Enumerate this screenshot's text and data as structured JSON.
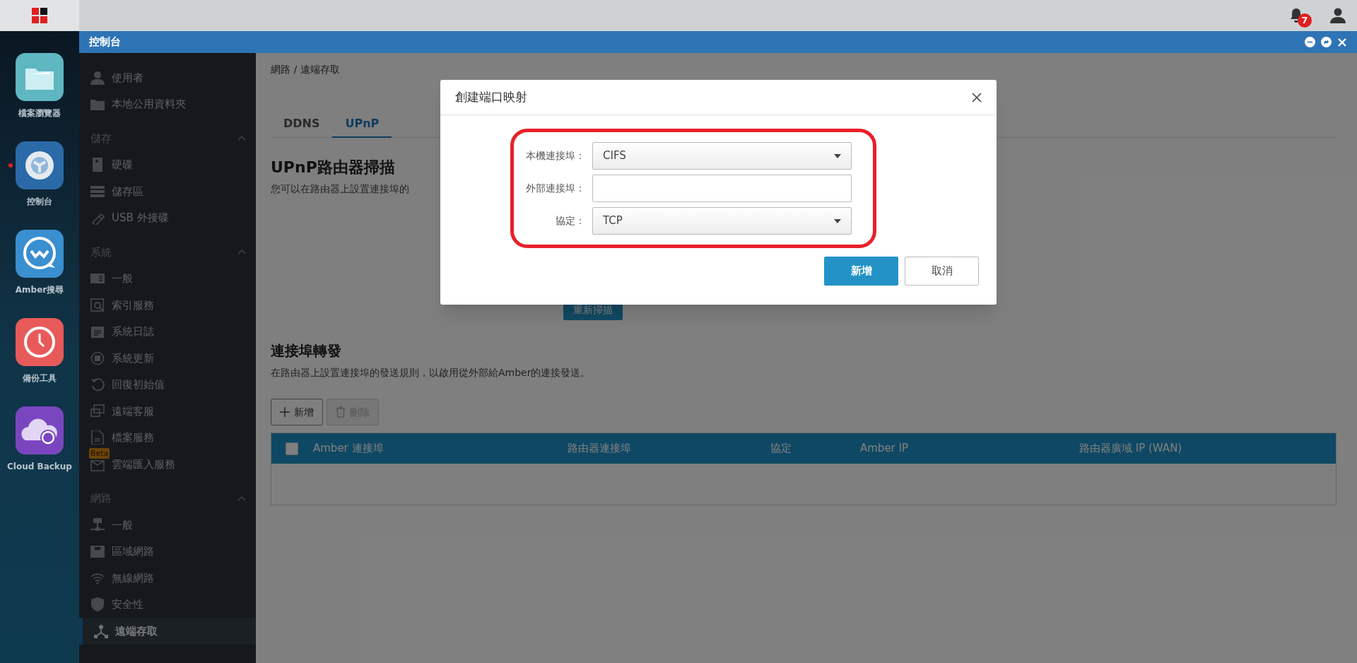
{
  "top_bar": {
    "notification_count": "7"
  },
  "dock": [
    {
      "label": "檔案瀏覽器",
      "running": false
    },
    {
      "label": "控制台",
      "running": true
    },
    {
      "label": "Amber搜尋",
      "running": false
    },
    {
      "label": "備份工具",
      "running": false
    },
    {
      "label": "Cloud Backup",
      "running": false
    }
  ],
  "window": {
    "title": "控制台"
  },
  "sidebar": {
    "sections": [
      {
        "items": [
          {
            "label": "使用者",
            "selected": false
          },
          {
            "label": "本地公用資料夾",
            "selected": false
          }
        ]
      },
      {
        "heading": "儲存",
        "items": [
          {
            "label": "硬碟",
            "selected": false
          },
          {
            "label": "儲存區",
            "selected": false
          },
          {
            "label": "USB 外接碟",
            "selected": false
          }
        ]
      },
      {
        "heading": "系統",
        "items": [
          {
            "label": "一般",
            "selected": false
          },
          {
            "label": "索引服務",
            "selected": false
          },
          {
            "label": "系統日誌",
            "selected": false
          },
          {
            "label": "系統更新",
            "selected": false
          },
          {
            "label": "回復初始值",
            "selected": false
          },
          {
            "label": "遠端客服",
            "selected": false
          },
          {
            "label": "檔案服務",
            "selected": false
          },
          {
            "label": "雲端匯入服務",
            "selected": false,
            "badge": "Beta"
          }
        ]
      },
      {
        "heading": "網路",
        "items": [
          {
            "label": "一般",
            "selected": false
          },
          {
            "label": "區域網路",
            "selected": false
          },
          {
            "label": "無線網路",
            "selected": false
          },
          {
            "label": "安全性",
            "selected": false
          },
          {
            "label": "遠端存取",
            "selected": true
          }
        ]
      }
    ]
  },
  "breadcrumb": "網路 / 遠端存取",
  "tabs": [
    {
      "label": "DDNS",
      "selected": false
    },
    {
      "label": "UPnP",
      "selected": true
    }
  ],
  "upnp_scan": {
    "title": "UPnP路由器掃描",
    "description": "您可以在路由器上設置連接埠的",
    "button": "重新掃描"
  },
  "port_forwarding": {
    "title": "連接埠轉發",
    "description": "在路由器上設置連接埠的發送規則，以啟用從外部給Amber的連接發送。",
    "actions": [
      {
        "label": "新增",
        "kind": "add",
        "disabled": false
      },
      {
        "label": "刪除",
        "kind": "delete",
        "disabled": true
      }
    ],
    "table": {
      "select_all_checked": false,
      "columns": [
        "Amber 連接埠",
        "路由器連接埠",
        "協定",
        "Amber IP",
        "路由器廣域 IP (WAN)"
      ]
    }
  },
  "dialog": {
    "title": "創建端口映射",
    "fields": [
      {
        "label": "本機連接埠：",
        "kind": "select",
        "value": "CIFS"
      },
      {
        "label": "外部連接埠：",
        "kind": "text"
      },
      {
        "label": "協定：",
        "kind": "select",
        "value": "TCP"
      }
    ],
    "buttons": [
      {
        "label": "新增",
        "kind": "primary"
      },
      {
        "label": "取消",
        "kind": "secondary"
      }
    ]
  }
}
